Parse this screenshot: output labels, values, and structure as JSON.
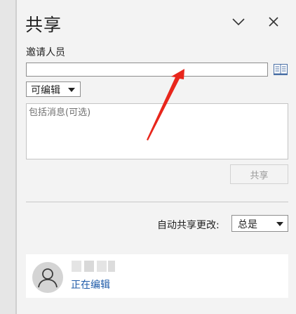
{
  "pane": {
    "title": "共享",
    "invite_label": "邀请人员",
    "invite_value": "",
    "permission": "可编辑",
    "message_placeholder": "包括消息(可选)",
    "share_button": "共享",
    "auto_share_label": "自动共享更改:",
    "auto_share_value": "总是"
  },
  "person": {
    "status": "正在编辑"
  },
  "icons": {
    "collapse": "chevron-down-icon",
    "close": "close-icon",
    "address_book": "address-book-icon",
    "avatar": "person-icon"
  },
  "colors": {
    "status_link": "#1e5aa8",
    "annotation_arrow": "#e8261c"
  }
}
